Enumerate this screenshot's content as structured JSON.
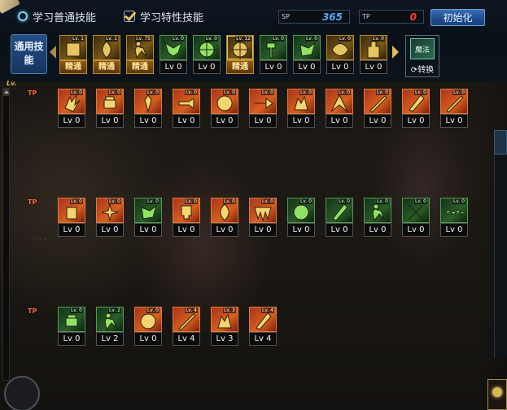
{
  "header": {
    "tab_normal": "学习普通技能",
    "tab_special": "学习特性技能",
    "sp_tag": "SP",
    "sp_value": "365",
    "tp_tag": "TP",
    "tp_value": "0",
    "reset_button": "初始化",
    "colors": {
      "sp": "#53a9ff",
      "tp": "#ff3a2a"
    }
  },
  "general": {
    "label": "通用技能",
    "skills": [
      {
        "icon": "scroll-icon",
        "level": "精通",
        "mini": "Lv. 1",
        "theme": "gold",
        "special": true
      },
      {
        "icon": "flame-icon",
        "level": "精通",
        "mini": "Lv. 1",
        "theme": "gold",
        "special": true
      },
      {
        "icon": "runner-icon",
        "level": "精通",
        "mini": "Lv. 75",
        "theme": "gold",
        "special": true
      },
      {
        "icon": "wings-icon",
        "level": "Lv 0",
        "mini": "Lv. 0",
        "theme": "green",
        "special": false
      },
      {
        "icon": "crosshair-icon",
        "level": "Lv 0",
        "mini": "Lv. 0",
        "theme": "green",
        "special": false
      },
      {
        "icon": "crosshair-icon",
        "level": "精通",
        "mini": "Lv. 12",
        "theme": "gold",
        "special": true,
        "selected": true
      },
      {
        "icon": "hammer-icon",
        "level": "Lv 0",
        "mini": "Lv. 0",
        "theme": "green",
        "special": false
      },
      {
        "icon": "kick-icon",
        "level": "Lv 0",
        "mini": "Lv. 0",
        "theme": "green",
        "special": false
      },
      {
        "icon": "eye-icon",
        "level": "Lv 0",
        "mini": "Lv. 0",
        "theme": "gold",
        "special": false
      },
      {
        "icon": "statue-icon",
        "level": "Lv 0",
        "mini": "Lv. 0",
        "theme": "gold",
        "special": false
      }
    ],
    "change_label": "转换",
    "change_icon_text": "魔法"
  },
  "lv_label": "Lv.",
  "rows": [
    {
      "tag": "TP",
      "skills": [
        {
          "icon": "claw-icon",
          "level": "Lv 0",
          "mini": "Lv. 0",
          "theme": "red"
        },
        {
          "icon": "fist-icon",
          "level": "Lv 0",
          "mini": "Lv. 0",
          "theme": "red"
        },
        {
          "icon": "warrior-icon",
          "level": "Lv 0",
          "mini": "Lv. 0",
          "theme": "red"
        },
        {
          "icon": "punch-icon",
          "level": "Lv 0",
          "mini": "Lv. 0",
          "theme": "red"
        },
        {
          "icon": "orb-icon",
          "level": "Lv 0",
          "mini": "Lv. 0",
          "theme": "red"
        },
        {
          "icon": "arrow-icon",
          "level": "Lv 0",
          "mini": "Lv. 0",
          "theme": "red"
        },
        {
          "icon": "beast-icon",
          "level": "Lv 0",
          "mini": "Lv. 0",
          "theme": "red"
        },
        {
          "icon": "spike-icon",
          "level": "Lv 0",
          "mini": "Lv. 0",
          "theme": "red"
        },
        {
          "icon": "slash-icon",
          "level": "Lv 0",
          "mini": "Lv. 0",
          "theme": "red"
        },
        {
          "icon": "blade-icon",
          "level": "Lv 0",
          "mini": "Lv. 0",
          "theme": "red"
        },
        {
          "icon": "slash-icon",
          "level": "Lv 0",
          "mini": "Lv. 0",
          "theme": "red"
        }
      ]
    },
    {
      "tag": "TP",
      "skills": [
        {
          "icon": "monster-icon",
          "level": "Lv 0",
          "mini": "Lv. 0",
          "theme": "red"
        },
        {
          "icon": "spark-icon",
          "level": "Lv 0",
          "mini": "Lv. 0",
          "theme": "red"
        },
        {
          "icon": "kick-icon",
          "level": "Lv 0",
          "mini": "Lv. 0",
          "theme": "green"
        },
        {
          "icon": "skull-icon",
          "level": "Lv 0",
          "mini": "Lv. 0",
          "theme": "red"
        },
        {
          "icon": "fire-icon",
          "level": "Lv 0",
          "mini": "Lv. 0",
          "theme": "red"
        },
        {
          "icon": "fangs-icon",
          "level": "Lv 0",
          "mini": "Lv. 0",
          "theme": "red"
        },
        {
          "icon": "orb-icon",
          "level": "Lv 0",
          "mini": "Lv. 0",
          "theme": "green"
        },
        {
          "icon": "blade-icon",
          "level": "Lv 0",
          "mini": "Lv. 0",
          "theme": "green"
        },
        {
          "icon": "runner-icon",
          "level": "Lv 0",
          "mini": "Lv. 0",
          "theme": "green"
        },
        {
          "icon": "cross-icon",
          "level": "Lv 0",
          "mini": "Lv. 0",
          "theme": "green"
        },
        {
          "icon": "wave-icon",
          "level": "Lv 0",
          "mini": "Lv. 0",
          "theme": "green"
        }
      ]
    },
    {
      "tag": "TP",
      "skills": [
        {
          "icon": "fist-icon",
          "level": "Lv 0",
          "mini": "Lv. 0",
          "theme": "green"
        },
        {
          "icon": "runner-icon",
          "level": "Lv 2",
          "mini": "Lv. 2",
          "theme": "green"
        },
        {
          "icon": "orb-icon",
          "level": "Lv 0",
          "mini": "Lv. 0",
          "theme": "red"
        },
        {
          "icon": "slash-icon",
          "level": "Lv 4",
          "mini": "Lv. 4",
          "theme": "red"
        },
        {
          "icon": "beast-icon",
          "level": "Lv 3",
          "mini": "Lv. 3",
          "theme": "red"
        },
        {
          "icon": "blade-icon",
          "level": "Lv 4",
          "mini": "Lv. 4",
          "theme": "red"
        }
      ]
    }
  ]
}
